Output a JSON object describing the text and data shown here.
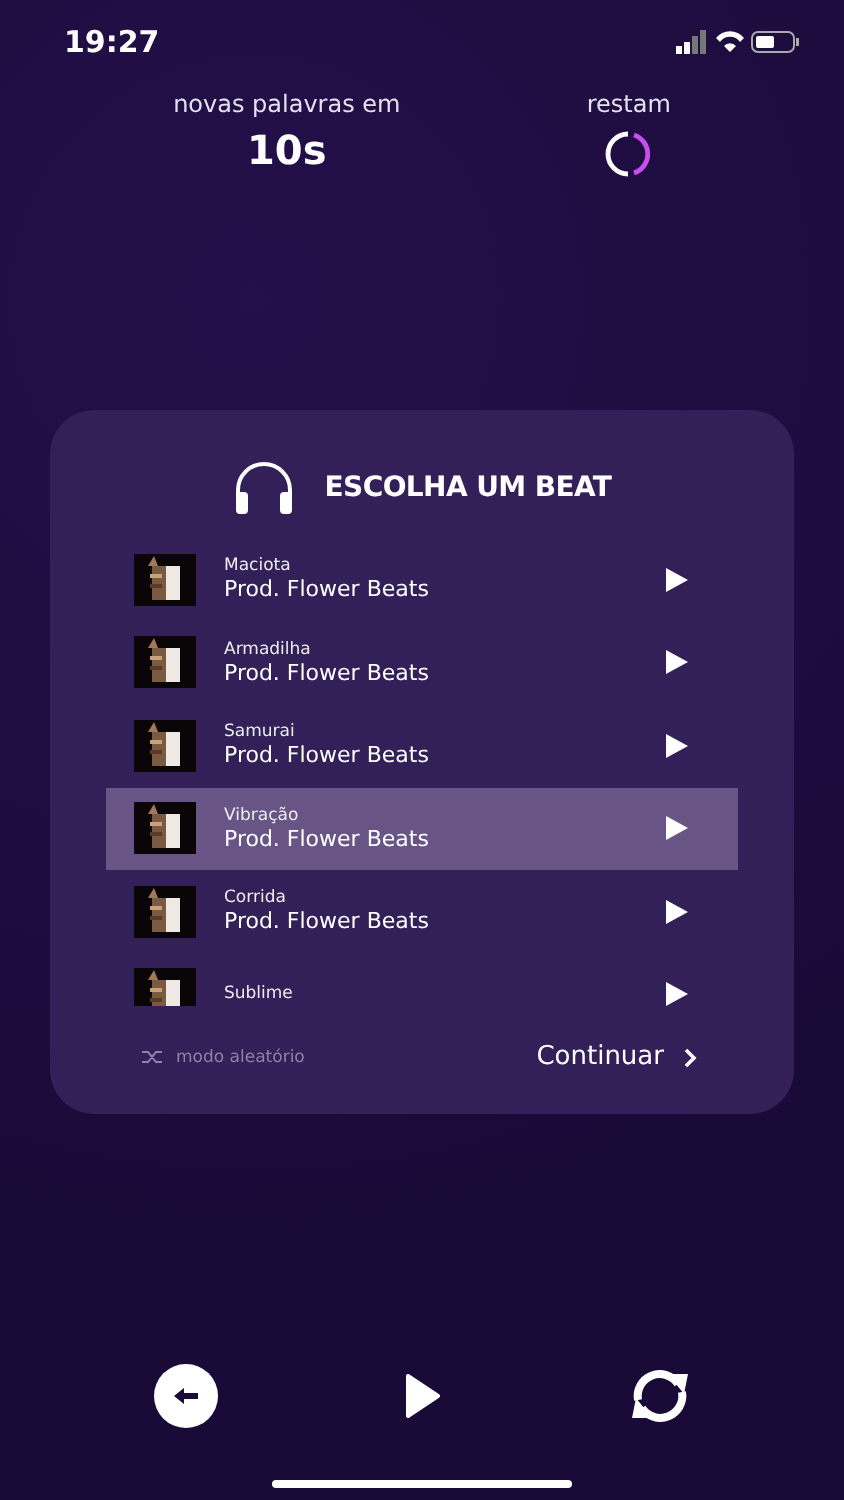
{
  "status_bar": {
    "time": "19:27"
  },
  "header": {
    "countdown_label": "novas palavras em",
    "countdown_value": "10s",
    "remaining_label": "restam"
  },
  "beat_panel": {
    "title": "ESCOLHA UM BEAT",
    "beats": [
      {
        "name": "Maciota",
        "producer": "Prod. Flower Beats",
        "selected": false
      },
      {
        "name": "Armadilha",
        "producer": "Prod. Flower Beats",
        "selected": false
      },
      {
        "name": "Samurai",
        "producer": "Prod. Flower Beats",
        "selected": false
      },
      {
        "name": "Vibração",
        "producer": "Prod. Flower Beats",
        "selected": true
      },
      {
        "name": "Corrida",
        "producer": "Prod. Flower Beats",
        "selected": false
      },
      {
        "name": "Sublime",
        "selected": false
      }
    ],
    "shuffle_label": "modo aleatório",
    "continue_label": "Continuar"
  }
}
